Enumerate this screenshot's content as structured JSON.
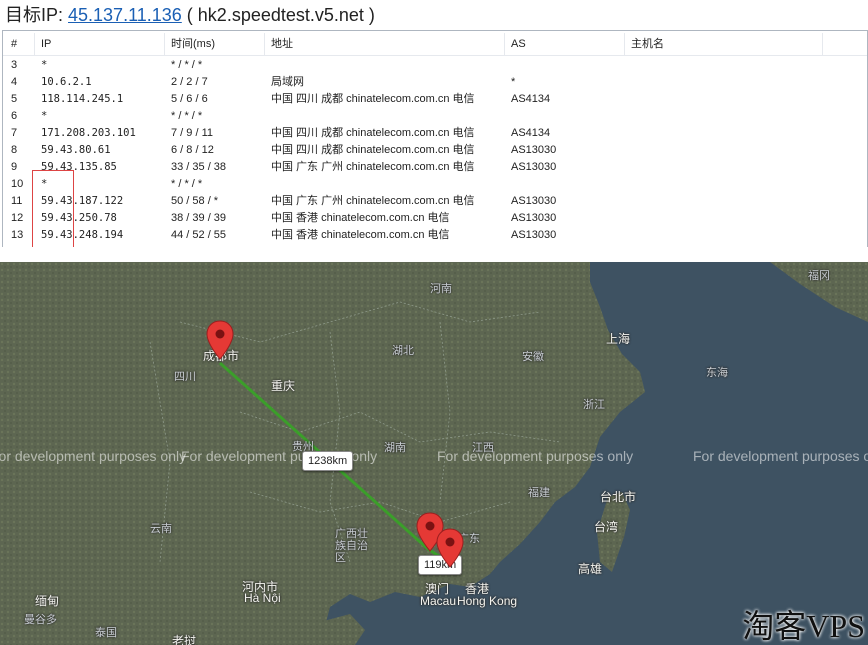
{
  "header": {
    "prefix": "目标IP: ",
    "ip": "45.137.11.136",
    "host": " ( hk2.speedtest.v5.net )"
  },
  "table": {
    "columns": [
      "#",
      "IP",
      "时间(ms)",
      "地址",
      "AS",
      "主机名"
    ],
    "rows": [
      {
        "n": "3",
        "ip": "*",
        "time": "* / * / *",
        "addr": "",
        "as": ""
      },
      {
        "n": "4",
        "ip": "10.6.2.1",
        "time": "2 / 2 / 7",
        "addr": "局域网",
        "as": "*"
      },
      {
        "n": "5",
        "ip": "118.114.245.1",
        "time": "5 / 6 / 6",
        "addr": "中国 四川 成都 chinatelecom.com.cn 电信",
        "as": "AS4134"
      },
      {
        "n": "6",
        "ip": "*",
        "time": "* / * / *",
        "addr": "",
        "as": ""
      },
      {
        "n": "7",
        "ip": "171.208.203.101",
        "time": "7 / 9 / 11",
        "addr": "中国 四川 成都 chinatelecom.com.cn 电信",
        "as": "AS4134"
      },
      {
        "n": "8",
        "ip": "59.43.80.61",
        "time": "6 / 8 / 12",
        "addr": "中国 四川 成都 chinatelecom.com.cn 电信",
        "as": "AS13030"
      },
      {
        "n": "9",
        "ip": "59.43.135.85",
        "time": "33 / 35 / 38",
        "addr": "中国 广东 广州 chinatelecom.com.cn 电信",
        "as": "AS13030"
      },
      {
        "n": "10",
        "ip": "*",
        "time": "* / * / *",
        "addr": "",
        "as": ""
      },
      {
        "n": "11",
        "ip": "59.43.187.122",
        "time": "50 / 58 / *",
        "addr": "中国 广东 广州 chinatelecom.com.cn 电信",
        "as": "AS13030"
      },
      {
        "n": "12",
        "ip": "59.43.250.78",
        "time": "38 / 39 / 39",
        "addr": "中国 香港 chinatelecom.com.cn 电信",
        "as": "AS13030"
      },
      {
        "n": "13",
        "ip": "59.43.248.194",
        "time": "44 / 52 / 55",
        "addr": "中国 香港 chinatelecom.com.cn 电信",
        "as": "AS13030"
      }
    ]
  },
  "map": {
    "watermark": "For development purposes only",
    "distances": [
      "1238km",
      "119km"
    ],
    "labels": [
      "福冈",
      "河南",
      "上海",
      "成都市",
      "湖北",
      "安徽",
      "四川",
      "重庆",
      "浙江",
      "东海",
      "湖南",
      "江西",
      "福建",
      "台北市",
      "台湾",
      "高雄",
      "广西壮族自治区",
      "广东",
      "澳门",
      "香港",
      "Macau",
      "Hong Kong",
      "河内市",
      "Hà Nội",
      "缅甸",
      "泰国",
      "老挝",
      "贵州",
      "云南",
      "曼谷多"
    ],
    "route_color": "#3b9e2a",
    "pin_color": "#e53935"
  },
  "brand": "淘客VPS"
}
